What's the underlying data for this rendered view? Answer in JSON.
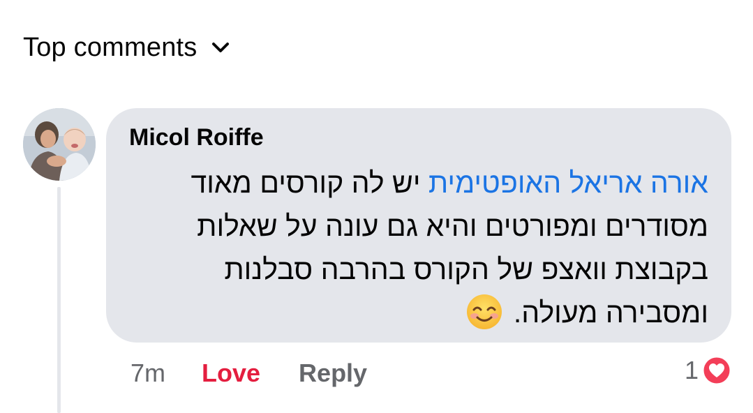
{
  "sort": {
    "label": "Top comments",
    "icon": "chevron-down-icon"
  },
  "comment": {
    "author": "Micol Roiffe",
    "avatar_icon": "user-avatar",
    "mention": "אורה אריאל האופטימית",
    "text_line1_rest": " יש לה קורסים מאוד",
    "text_line2": "מסודרים ומפורטים והיא גם עונה על שאלות",
    "text_line3": "בקבוצת וואצפ של הקורס בהרבה סבלנות",
    "text_line4": "ומסבירה מעולה.",
    "emoji_icon": "smiling-face-with-smiling-eyes-icon",
    "time": "7m",
    "love_label": "Love",
    "reply_label": "Reply",
    "reaction_count": "1",
    "reaction_icon": "love-reaction-icon"
  },
  "colors": {
    "bubble_bg": "#e4e6eb",
    "mention_blue": "#1b74e4",
    "love_red": "#e41e3f",
    "secondary_text": "#65676b"
  }
}
